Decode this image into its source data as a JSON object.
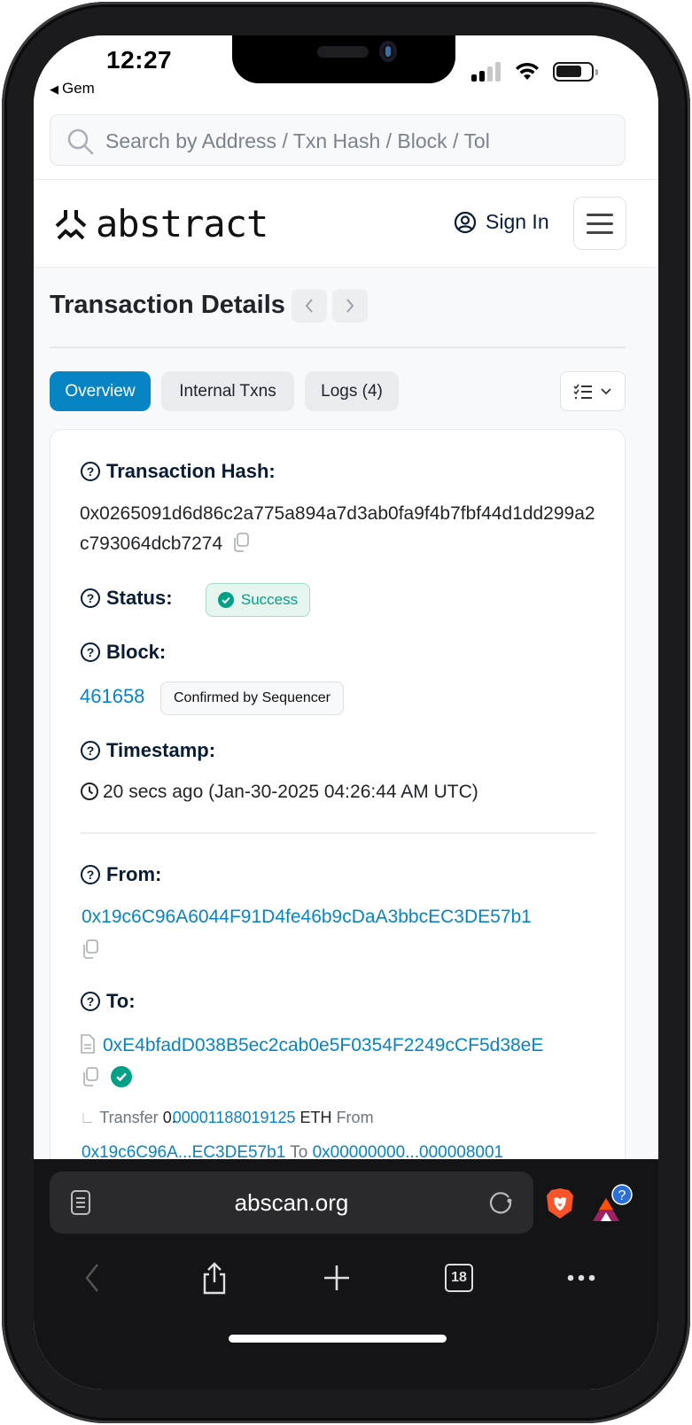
{
  "status_bar": {
    "time": "12:27",
    "back_app": "Gem"
  },
  "search": {
    "placeholder": "Search by Address / Txn Hash / Block / Tol"
  },
  "header": {
    "logo_text": "abstract",
    "sign_in_label": "Sign In"
  },
  "page": {
    "title": "Transaction Details",
    "prev_label": "‹",
    "next_label": "›"
  },
  "tabs": [
    {
      "label": "Overview",
      "active": true
    },
    {
      "label": "Internal Txns",
      "active": false
    },
    {
      "label": "Logs (4)",
      "active": false
    }
  ],
  "details": {
    "tx_hash_label": "Transaction Hash:",
    "tx_hash": "0x0265091d6d86c2a775a894a7d3ab0fa9f4b7fbf44d1dd299a2c793064dcb7274",
    "status_label": "Status:",
    "status_value": "Success",
    "block_label": "Block:",
    "block_number": "461658",
    "block_badge": "Confirmed by Sequencer",
    "timestamp_label": "Timestamp:",
    "timestamp_value": "20 secs ago (Jan-30-2025 04:26:44 AM UTC)",
    "from_label": "From:",
    "from_address": "0x19c6C96A6044F91D4fe46b9cDaA3bbcEC3DE57b1",
    "to_label": "To:",
    "to_address": "0xE4bfadD038B5ec2cab0e5F0354F2249cCF5d38eE",
    "transfer": {
      "prefix": "Transfer",
      "amount_int": "0.",
      "amount_dec": "00001188019125",
      "unit": "ETH",
      "from_word": "From",
      "from_short": "0x19c6C96A...EC3DE57b1",
      "to_word": "To",
      "to_short": "0x00000000...000008001"
    }
  },
  "browser": {
    "url": "abscan.org",
    "tab_count": "18"
  },
  "colors": {
    "accent": "#0784c3",
    "success": "#00a186",
    "heading": "#081d35"
  }
}
